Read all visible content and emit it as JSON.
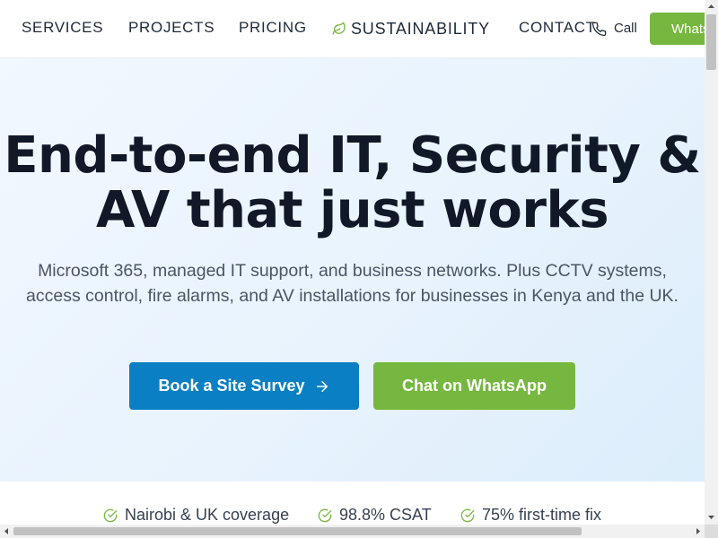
{
  "nav": {
    "items": [
      {
        "label": "SERVICES"
      },
      {
        "label": "PROJECTS"
      },
      {
        "label": "PRICING"
      },
      {
        "label": "SUSTAINABILITY",
        "icon": "leaf-icon"
      },
      {
        "label": "CONTACT"
      }
    ],
    "call_label": "Call",
    "whatsapp_label": "WhatsApp"
  },
  "hero": {
    "title_line1": "End-to-end IT, Security &",
    "title_line2": "AV that just works",
    "subtitle": "Microsoft 365, managed IT support, and business networks. Plus CCTV systems, access control, fire alarms, and AV installations for businesses in Kenya and the UK.",
    "primary_cta": "Book a Site Survey",
    "secondary_cta": "Chat on WhatsApp"
  },
  "stats": [
    {
      "label": "Nairobi & UK coverage"
    },
    {
      "label": "98.8% CSAT"
    },
    {
      "label": "75% first-time fix"
    }
  ],
  "colors": {
    "brand_blue": "#0b7fc3",
    "brand_green": "#76b83f",
    "heading": "#111827",
    "body_text": "#4b5563"
  }
}
